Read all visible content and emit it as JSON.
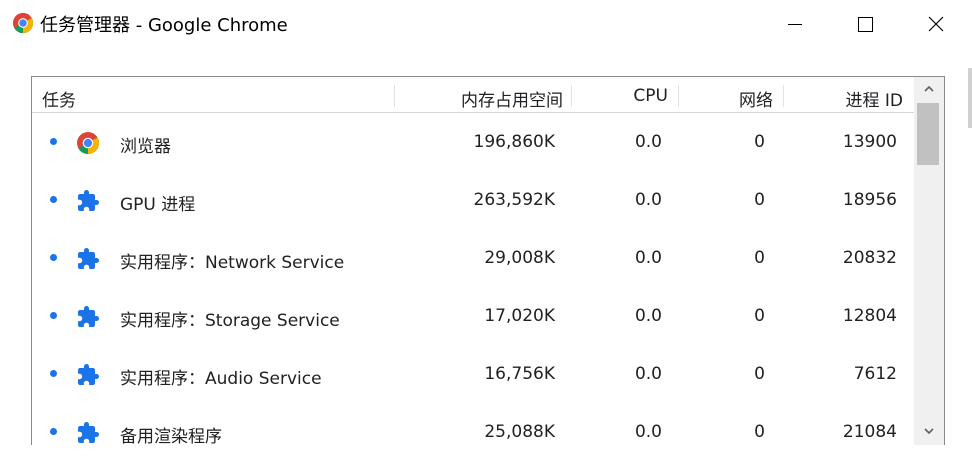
{
  "window": {
    "title": "任务管理器 - Google Chrome",
    "app_icon": "chrome-icon",
    "controls": [
      "minimize-icon",
      "maximize-icon",
      "close-icon"
    ]
  },
  "table": {
    "columns": {
      "task": "任务",
      "memory": "内存占用空间",
      "cpu": "CPU",
      "network": "网络",
      "pid": "进程 ID"
    },
    "rows": [
      {
        "icon": "chrome-icon",
        "task": "浏览器",
        "memory": "196,860K",
        "cpu": "0.0",
        "network": "0",
        "pid": "13900"
      },
      {
        "icon": "puzzle-icon",
        "task": "GPU 进程",
        "memory": "263,592K",
        "cpu": "0.0",
        "network": "0",
        "pid": "18956"
      },
      {
        "icon": "puzzle-icon",
        "task": "实用程序：Network Service",
        "memory": "29,008K",
        "cpu": "0.0",
        "network": "0",
        "pid": "20832"
      },
      {
        "icon": "puzzle-icon",
        "task": "实用程序：Storage Service",
        "memory": "17,020K",
        "cpu": "0.0",
        "network": "0",
        "pid": "12804"
      },
      {
        "icon": "puzzle-icon",
        "task": "实用程序：Audio Service",
        "memory": "16,756K",
        "cpu": "0.0",
        "network": "0",
        "pid": "7612"
      },
      {
        "icon": "puzzle-icon",
        "task": "备用渲染程序",
        "memory": "25,088K",
        "cpu": "0.0",
        "network": "0",
        "pid": "21084"
      }
    ]
  },
  "colors": {
    "bullet": "#1a73e8",
    "extension_icon": "#1a73e8"
  }
}
